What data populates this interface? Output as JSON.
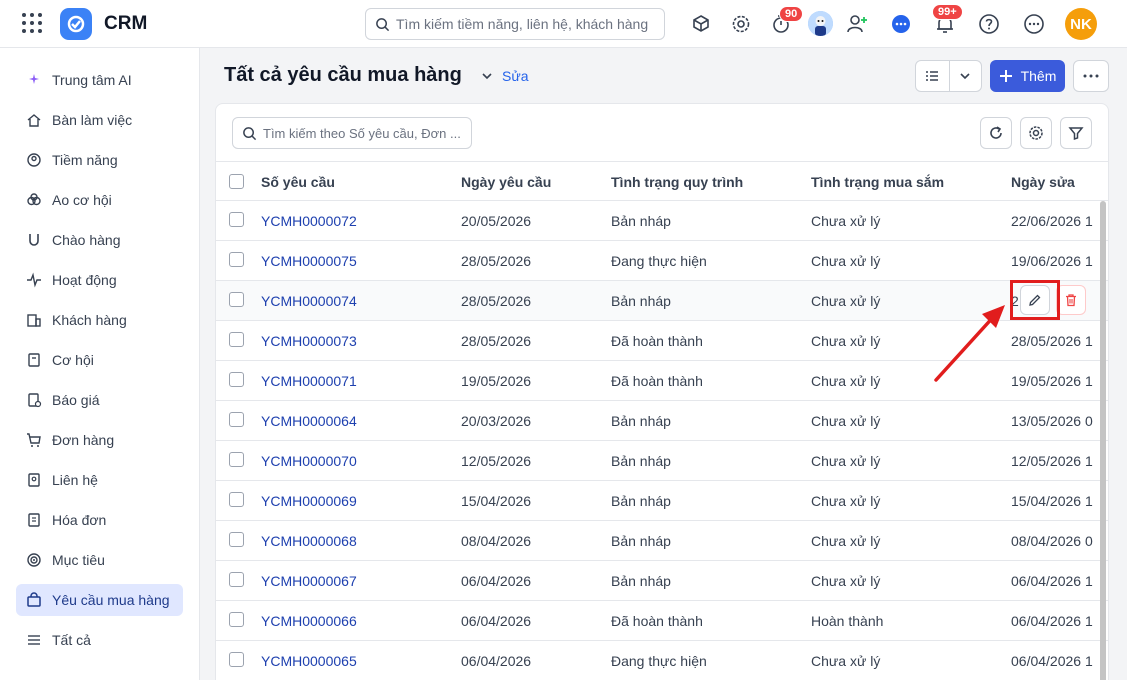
{
  "app": {
    "name": "CRM"
  },
  "search": {
    "placeholder": "Tìm kiếm tiềm năng, liên hệ, khách hàng"
  },
  "topbar": {
    "timer_badge": "90",
    "notification_badge": "99+",
    "user_initials": "NK",
    "icons": [
      "apps-grid-icon",
      "crm-logo-icon",
      "search-icon",
      "box-search-icon",
      "gear-icon",
      "timer-icon",
      "user-avatar",
      "add-user-icon",
      "chat-icon",
      "bell-icon",
      "help-icon",
      "more-icon"
    ]
  },
  "sidebar": {
    "items": [
      {
        "label": "Trung tâm AI",
        "icon": "sparkle-icon"
      },
      {
        "label": "Bàn làm việc",
        "icon": "home-icon"
      },
      {
        "label": "Tiềm năng",
        "icon": "target-user-icon"
      },
      {
        "label": "Ao cơ hội",
        "icon": "pool-icon"
      },
      {
        "label": "Chào hàng",
        "icon": "magnet-icon"
      },
      {
        "label": "Hoạt động",
        "icon": "activity-icon"
      },
      {
        "label": "Khách hàng",
        "icon": "building-icon"
      },
      {
        "label": "Cơ hội",
        "icon": "opportunity-icon"
      },
      {
        "label": "Báo giá",
        "icon": "quote-icon"
      },
      {
        "label": "Đơn hàng",
        "icon": "cart-icon"
      },
      {
        "label": "Liên hệ",
        "icon": "contact-icon"
      },
      {
        "label": "Hóa đơn",
        "icon": "invoice-icon"
      },
      {
        "label": "Mục tiêu",
        "icon": "goal-icon"
      },
      {
        "label": "Yêu cầu mua hàng",
        "icon": "shopping-bag-icon",
        "active": true
      },
      {
        "label": "Tất cả",
        "icon": "list-icon"
      }
    ]
  },
  "header": {
    "title": "Tất cả yêu cầu mua hàng",
    "edit_label": "Sửa",
    "add_label": "Thêm"
  },
  "table": {
    "search_placeholder": "Tìm kiếm theo Số yêu cầu, Đơn ...",
    "columns": [
      "Số yêu cầu",
      "Ngày yêu cầu",
      "Tình trạng quy trình",
      "Tình trạng mua sắm",
      "Ngày sửa"
    ],
    "rows": [
      {
        "code": "YCMH0000072",
        "date": "20/05/2026",
        "process": "Bản nháp",
        "purchase": "Chưa xử lý",
        "modified": "22/06/2026 1"
      },
      {
        "code": "YCMH0000075",
        "date": "28/05/2026",
        "process": "Đang thực hiện",
        "purchase": "Chưa xử lý",
        "modified": "19/06/2026 1"
      },
      {
        "code": "YCMH0000074",
        "date": "28/05/2026",
        "process": "Bản nháp",
        "purchase": "Chưa xử lý",
        "modified": "2"
      },
      {
        "code": "YCMH0000073",
        "date": "28/05/2026",
        "process": "Đã hoàn thành",
        "purchase": "Chưa xử lý",
        "modified": "28/05/2026 1"
      },
      {
        "code": "YCMH0000071",
        "date": "19/05/2026",
        "process": "Đã hoàn thành",
        "purchase": "Chưa xử lý",
        "modified": "19/05/2026 1"
      },
      {
        "code": "YCMH0000064",
        "date": "20/03/2026",
        "process": "Bản nháp",
        "purchase": "Chưa xử lý",
        "modified": "13/05/2026 0"
      },
      {
        "code": "YCMH0000070",
        "date": "12/05/2026",
        "process": "Bản nháp",
        "purchase": "Chưa xử lý",
        "modified": "12/05/2026 1"
      },
      {
        "code": "YCMH0000069",
        "date": "15/04/2026",
        "process": "Bản nháp",
        "purchase": "Chưa xử lý",
        "modified": "15/04/2026 1"
      },
      {
        "code": "YCMH0000068",
        "date": "08/04/2026",
        "process": "Bản nháp",
        "purchase": "Chưa xử lý",
        "modified": "08/04/2026 0"
      },
      {
        "code": "YCMH0000067",
        "date": "06/04/2026",
        "process": "Bản nháp",
        "purchase": "Chưa xử lý",
        "modified": "06/04/2026 1"
      },
      {
        "code": "YCMH0000066",
        "date": "06/04/2026",
        "process": "Đã hoàn thành",
        "purchase": "Hoàn thành",
        "modified": "06/04/2026 1"
      },
      {
        "code": "YCMH0000065",
        "date": "06/04/2026",
        "process": "Đang thực hiện",
        "purchase": "Chưa xử lý",
        "modified": "06/04/2026 1"
      }
    ],
    "hovered_row": 2,
    "row_actions": [
      "edit-icon",
      "delete-icon"
    ]
  },
  "colors": {
    "accent": "#3b5bdb",
    "link": "#1e40af",
    "badge": "#ef4444",
    "annotation": "#e11d1d",
    "active_bg": "#e0e7ff"
  }
}
